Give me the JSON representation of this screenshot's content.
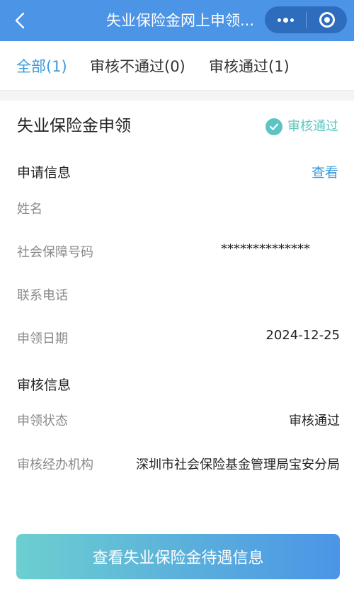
{
  "header": {
    "title": "失业保险金网上申领...",
    "icons": {
      "back": "back-arrow-icon",
      "more": "more-dots-icon",
      "close": "target-close-icon"
    }
  },
  "tabs": [
    {
      "label": "全部(1)",
      "active": true
    },
    {
      "label": "审核不通过(0)",
      "active": false
    },
    {
      "label": "审核通过(1)",
      "active": false
    }
  ],
  "card": {
    "title": "失业保险金申领",
    "status": "审核通过",
    "status_color": "#5cc4c2",
    "application_section": {
      "title": "申请信息",
      "view_link": "查看",
      "fields": [
        {
          "label": "姓名",
          "value": ""
        },
        {
          "label": "社会保障号码",
          "value": "**************"
        },
        {
          "label": "联系电话",
          "value": ""
        },
        {
          "label": "申领日期",
          "value": "2024-12-25"
        }
      ]
    },
    "review_section": {
      "title": "审核信息",
      "fields": [
        {
          "label": "申领状态",
          "value": "审核通过"
        },
        {
          "label": "审核经办机构",
          "value": "深圳市社会保险基金管理局宝安分局"
        }
      ]
    }
  },
  "bottom_button": {
    "label": "查看失业保险金待遇信息"
  },
  "colors": {
    "header_bg": "#4b94e6",
    "accent": "#3a9bd8",
    "success": "#5cc4c2"
  }
}
